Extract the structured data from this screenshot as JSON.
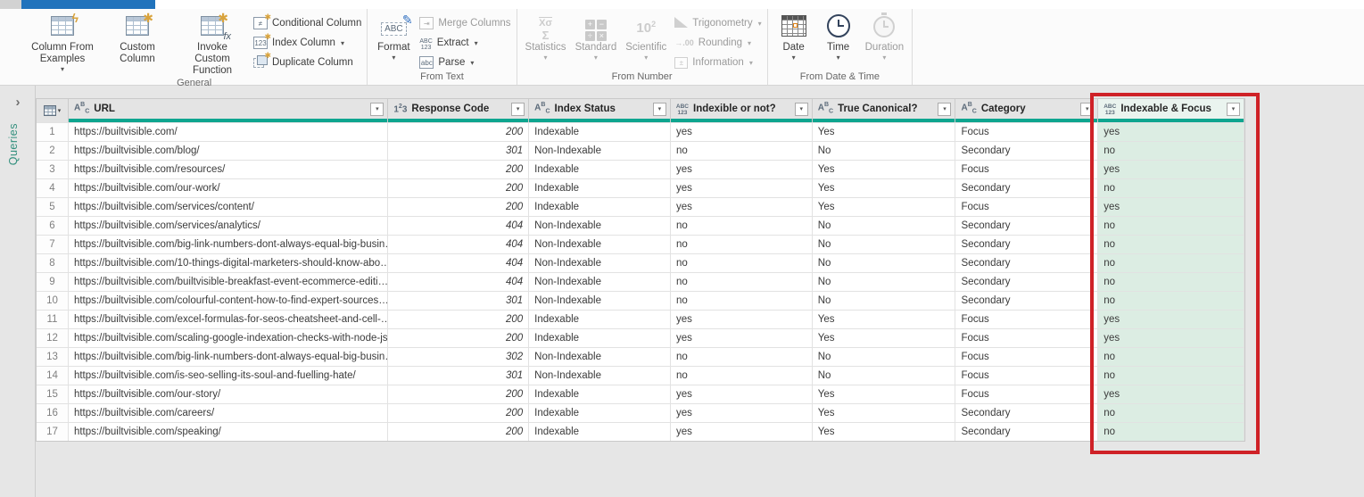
{
  "colors": {
    "active_tab_blue": "#2173bc",
    "accent_teal": "#0ea58f",
    "selected_column_bg": "#dcede3",
    "selected_header_bg": "#eaf4ef",
    "annotation_red": "#cf2127"
  },
  "ribbon": {
    "groups": [
      {
        "label": "General",
        "items": [
          {
            "label": "Column From Examples",
            "size": "large",
            "dropdown": true,
            "enabled": true,
            "icon": "table-lightning-icon"
          },
          {
            "label": "Custom Column",
            "size": "large",
            "dropdown": false,
            "enabled": true,
            "icon": "table-star-icon"
          },
          {
            "label": "Invoke Custom Function",
            "size": "large",
            "dropdown": false,
            "enabled": true,
            "icon": "table-fx-icon"
          },
          {
            "label": "Conditional Column",
            "size": "small",
            "dropdown": false,
            "enabled": true,
            "icon": "conditional-column-icon"
          },
          {
            "label": "Index Column",
            "size": "small",
            "dropdown": true,
            "enabled": true,
            "icon": "index-column-icon"
          },
          {
            "label": "Duplicate Column",
            "size": "small",
            "dropdown": false,
            "enabled": true,
            "icon": "duplicate-column-icon"
          }
        ]
      },
      {
        "label": "From Text",
        "items": [
          {
            "label": "Format",
            "size": "large",
            "dropdown": true,
            "enabled": true,
            "icon": "format-abc-pencil-icon"
          },
          {
            "label": "Merge Columns",
            "size": "small",
            "dropdown": false,
            "enabled": false,
            "icon": "merge-columns-icon"
          },
          {
            "label": "Extract",
            "size": "small",
            "dropdown": true,
            "enabled": true,
            "icon": "extract-abc123-icon"
          },
          {
            "label": "Parse",
            "size": "small",
            "dropdown": true,
            "enabled": true,
            "icon": "parse-abc-icon"
          }
        ]
      },
      {
        "label": "From Number",
        "items": [
          {
            "label": "Statistics",
            "size": "large",
            "dropdown": true,
            "enabled": false,
            "icon": "statistics-sigma-icon"
          },
          {
            "label": "Standard",
            "size": "large",
            "dropdown": true,
            "enabled": false,
            "icon": "standard-operators-icon"
          },
          {
            "label": "Scientific",
            "size": "large",
            "dropdown": true,
            "enabled": false,
            "icon": "scientific-10-squared-icon"
          },
          {
            "label": "Trigonometry",
            "size": "small",
            "dropdown": true,
            "enabled": false,
            "icon": "trigonometry-icon"
          },
          {
            "label": "Rounding",
            "size": "small",
            "dropdown": true,
            "enabled": false,
            "icon": "rounding-icon"
          },
          {
            "label": "Information",
            "size": "small",
            "dropdown": true,
            "enabled": false,
            "icon": "information-icon"
          }
        ]
      },
      {
        "label": "From Date & Time",
        "items": [
          {
            "label": "Date",
            "size": "large",
            "dropdown": true,
            "enabled": true,
            "icon": "calendar-icon"
          },
          {
            "label": "Time",
            "size": "large",
            "dropdown": true,
            "enabled": true,
            "icon": "clock-icon"
          },
          {
            "label": "Duration",
            "size": "large",
            "dropdown": true,
            "enabled": false,
            "icon": "stopwatch-icon"
          }
        ]
      }
    ]
  },
  "sidebar": {
    "label": "Queries",
    "chevron": "›"
  },
  "table": {
    "corner_icon": "select-all-table-icon",
    "columns": [
      {
        "name": "URL",
        "type": "text"
      },
      {
        "name": "Response Code",
        "type": "number"
      },
      {
        "name": "Index Status",
        "type": "text"
      },
      {
        "name": "Indexible or not?",
        "type": "any"
      },
      {
        "name": "True Canonical?",
        "type": "text"
      },
      {
        "name": "Category",
        "type": "text"
      },
      {
        "name": "Indexable & Focus",
        "type": "any",
        "selected": true
      }
    ],
    "rows": [
      {
        "num": "1",
        "cells": [
          "https://builtvisible.com/",
          "200",
          "Indexable",
          "yes",
          "Yes",
          "Focus",
          "yes"
        ]
      },
      {
        "num": "2",
        "cells": [
          "https://builtvisible.com/blog/",
          "301",
          "Non-Indexable",
          "no",
          "No",
          "Secondary",
          "no"
        ]
      },
      {
        "num": "3",
        "cells": [
          "https://builtvisible.com/resources/",
          "200",
          "Indexable",
          "yes",
          "Yes",
          "Focus",
          "yes"
        ]
      },
      {
        "num": "4",
        "cells": [
          "https://builtvisible.com/our-work/",
          "200",
          "Indexable",
          "yes",
          "Yes",
          "Secondary",
          "no"
        ]
      },
      {
        "num": "5",
        "cells": [
          "https://builtvisible.com/services/content/",
          "200",
          "Indexable",
          "yes",
          "Yes",
          "Focus",
          "yes"
        ]
      },
      {
        "num": "6",
        "cells": [
          "https://builtvisible.com/services/analytics/",
          "404",
          "Non-Indexable",
          "no",
          "No",
          "Secondary",
          "no"
        ]
      },
      {
        "num": "7",
        "cells": [
          "https://builtvisible.com/big-link-numbers-dont-always-equal-big-busin…",
          "404",
          "Non-Indexable",
          "no",
          "No",
          "Secondary",
          "no"
        ]
      },
      {
        "num": "8",
        "cells": [
          "https://builtvisible.com/10-things-digital-marketers-should-know-abo…",
          "404",
          "Non-Indexable",
          "no",
          "No",
          "Secondary",
          "no"
        ]
      },
      {
        "num": "9",
        "cells": [
          "https://builtvisible.com/builtvisible-breakfast-event-ecommerce-editi…",
          "404",
          "Non-Indexable",
          "no",
          "No",
          "Secondary",
          "no"
        ]
      },
      {
        "num": "10",
        "cells": [
          "https://builtvisible.com/colourful-content-how-to-find-expert-sources…",
          "301",
          "Non-Indexable",
          "no",
          "No",
          "Secondary",
          "no"
        ]
      },
      {
        "num": "11",
        "cells": [
          "https://builtvisible.com/excel-formulas-for-seos-cheatsheet-and-cell-…",
          "200",
          "Indexable",
          "yes",
          "Yes",
          "Focus",
          "yes"
        ]
      },
      {
        "num": "12",
        "cells": [
          "https://builtvisible.com/scaling-google-indexation-checks-with-node-js/",
          "200",
          "Indexable",
          "yes",
          "Yes",
          "Focus",
          "yes"
        ]
      },
      {
        "num": "13",
        "cells": [
          "https://builtvisible.com/big-link-numbers-dont-always-equal-big-busin…",
          "302",
          "Non-Indexable",
          "no",
          "No",
          "Focus",
          "no"
        ]
      },
      {
        "num": "14",
        "cells": [
          "https://builtvisible.com/is-seo-selling-its-soul-and-fuelling-hate/",
          "301",
          "Non-Indexable",
          "no",
          "No",
          "Focus",
          "no"
        ]
      },
      {
        "num": "15",
        "cells": [
          "https://builtvisible.com/our-story/",
          "200",
          "Indexable",
          "yes",
          "Yes",
          "Focus",
          "yes"
        ]
      },
      {
        "num": "16",
        "cells": [
          "https://builtvisible.com/careers/",
          "200",
          "Indexable",
          "yes",
          "Yes",
          "Secondary",
          "no"
        ]
      },
      {
        "num": "17",
        "cells": [
          "https://builtvisible.com/speaking/",
          "200",
          "Indexable",
          "yes",
          "Yes",
          "Secondary",
          "no"
        ]
      }
    ]
  }
}
